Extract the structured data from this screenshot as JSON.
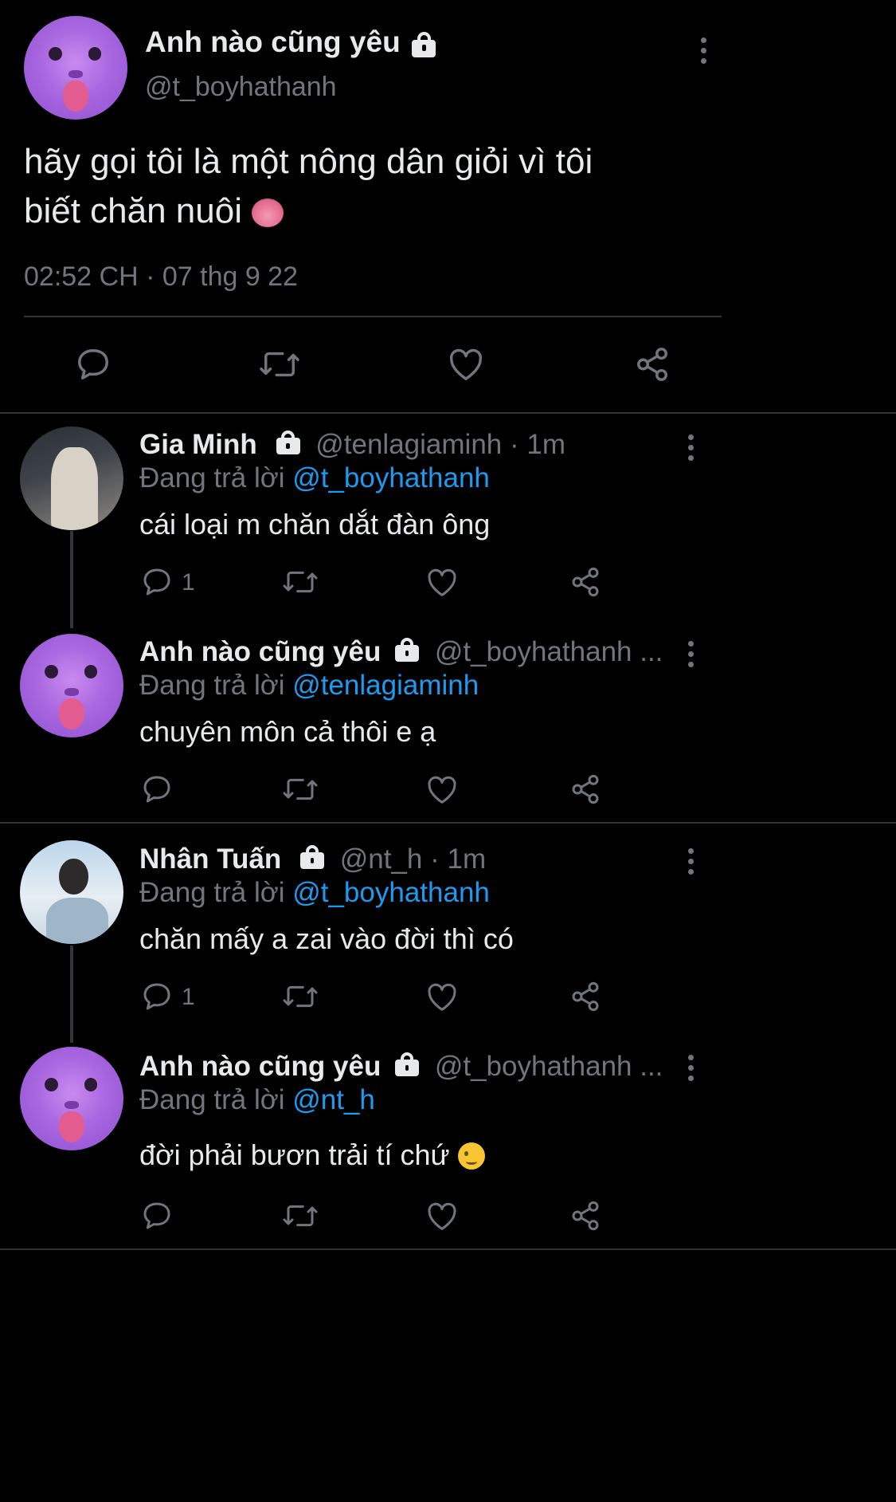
{
  "main_tweet": {
    "display_name": "Anh nào cũng yêu",
    "handle": "@t_boyhathanh",
    "text_line1": "hãy gọi tôi là một nông dân giỏi vì tôi",
    "text_line2": "biết chăn nuôi",
    "timestamp": "02:52 CH · 07 thg 9 22"
  },
  "replies": [
    {
      "display_name": "Gia Minh",
      "handle": "@tenlagiaminh",
      "time": "· 1m",
      "replying_label": "Đang trả lời",
      "replying_to": "@t_boyhathanh",
      "text": "cái loại m chăn dắt đàn ông",
      "reply_count": "1"
    },
    {
      "display_name": "Anh nào cũng yêu",
      "handle": "@t_boyhathanh ...",
      "time": "",
      "replying_label": "Đang trả lời",
      "replying_to": "@tenlagiaminh",
      "text": "chuyên môn cả thôi e ạ",
      "reply_count": ""
    },
    {
      "display_name": "Nhân Tuấn",
      "handle": "@nt_h",
      "time": "· 1m",
      "replying_label": "Đang trả lời",
      "replying_to": "@t_boyhathanh",
      "text": "chăn mấy a zai vào đời thì có",
      "reply_count": "1"
    },
    {
      "display_name": "Anh nào cũng yêu",
      "handle": "@t_boyhathanh ...",
      "time": "",
      "replying_label": "Đang trả lời",
      "replying_to": "@nt_h",
      "text": "đời phải bươn trải tí chứ",
      "reply_count": ""
    }
  ],
  "icons": [
    "reply-icon",
    "retweet-icon",
    "like-icon",
    "share-icon",
    "lock-icon",
    "more-icon"
  ],
  "colors": {
    "background": "#000000",
    "text": "#e7e9ea",
    "secondary": "#71767b",
    "link": "#1d9bf0",
    "avatar_purple": "#a967e0"
  }
}
